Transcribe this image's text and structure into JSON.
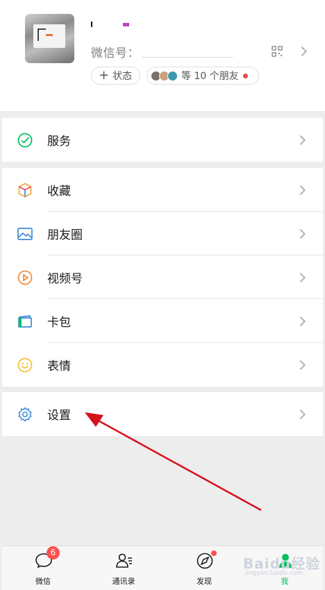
{
  "profile": {
    "wxid_label": "微信号：",
    "status_label": "状态",
    "friends_label": "等 10 个朋友"
  },
  "menu": {
    "services": "服务",
    "favorites": "收藏",
    "moments": "朋友圈",
    "channels": "视频号",
    "cards": "卡包",
    "stickers": "表情",
    "settings": "设置"
  },
  "tabbar": {
    "chats": "微信",
    "chats_badge": "6",
    "contacts": "通讯录",
    "discover": "发现",
    "me": "我"
  },
  "watermark": {
    "text": "Baidu经验",
    "sub": "jingyan.baidu.com"
  },
  "colors": {
    "accent_green": "#07c160",
    "badge_red": "#fa5151",
    "arrow_red": "#d6111a"
  }
}
